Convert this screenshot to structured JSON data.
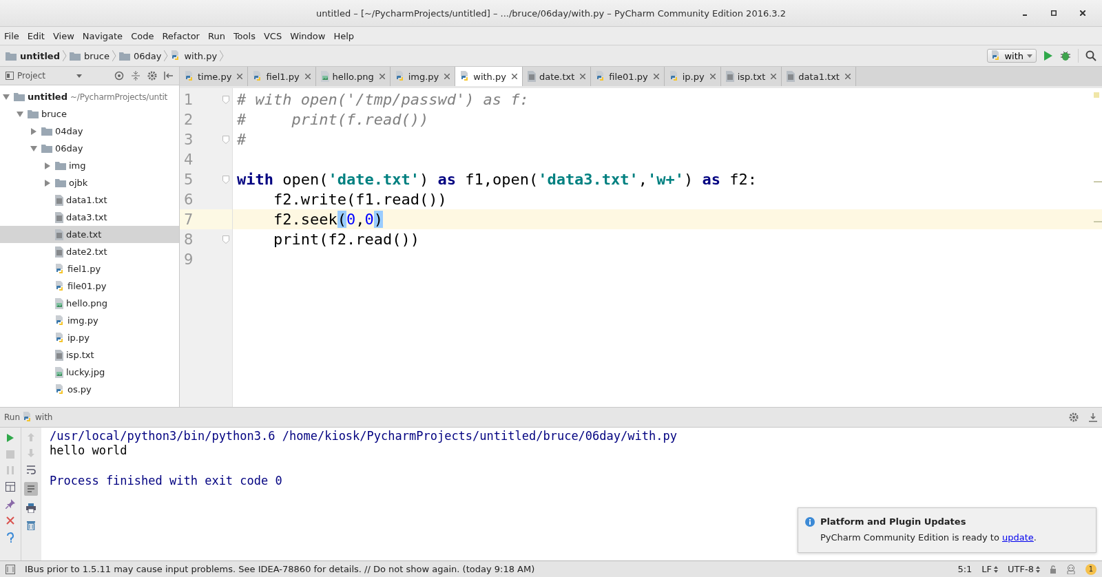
{
  "window": {
    "title": "untitled – [~/PycharmProjects/untitled] – .../bruce/06day/with.py – PyCharm Community Edition 2016.3.2"
  },
  "menu": [
    "File",
    "Edit",
    "View",
    "Navigate",
    "Code",
    "Refactor",
    "Run",
    "Tools",
    "VCS",
    "Window",
    "Help"
  ],
  "breadcrumbs": [
    {
      "label": "untitled",
      "kind": "folder",
      "bold": true
    },
    {
      "label": "bruce",
      "kind": "folder",
      "bold": false
    },
    {
      "label": "06day",
      "kind": "folder",
      "bold": false
    },
    {
      "label": "with.py",
      "kind": "py",
      "bold": false
    }
  ],
  "run_config": {
    "label": "with"
  },
  "project_panel": {
    "title": "Project"
  },
  "tree": [
    {
      "label": "untitled",
      "path": "~/PycharmProjects/untit",
      "kind": "folder",
      "expanded": true,
      "selected": false,
      "children": [
        {
          "label": "bruce",
          "kind": "folder",
          "expanded": true,
          "selected": false,
          "children": [
            {
              "label": "04day",
              "kind": "folder",
              "expanded": false,
              "selected": false
            },
            {
              "label": "06day",
              "kind": "folder",
              "expanded": true,
              "selected": false,
              "children": [
                {
                  "label": "img",
                  "kind": "folder",
                  "expanded": false,
                  "selected": false
                },
                {
                  "label": "ojbk",
                  "kind": "folder",
                  "expanded": false,
                  "selected": false
                },
                {
                  "label": "data1.txt",
                  "kind": "txt",
                  "selected": false
                },
                {
                  "label": "data3.txt",
                  "kind": "txt",
                  "selected": false
                },
                {
                  "label": "date.txt",
                  "kind": "txt",
                  "selected": true
                },
                {
                  "label": "date2.txt",
                  "kind": "txt",
                  "selected": false
                },
                {
                  "label": "fiel1.py",
                  "kind": "py",
                  "selected": false
                },
                {
                  "label": "file01.py",
                  "kind": "py",
                  "selected": false
                },
                {
                  "label": "hello.png",
                  "kind": "image",
                  "selected": false
                },
                {
                  "label": "img.py",
                  "kind": "py",
                  "selected": false
                },
                {
                  "label": "ip.py",
                  "kind": "py",
                  "selected": false
                },
                {
                  "label": "isp.txt",
                  "kind": "txt",
                  "selected": false
                },
                {
                  "label": "lucky.jpg",
                  "kind": "image",
                  "selected": false
                },
                {
                  "label": "os.py",
                  "kind": "py",
                  "selected": false
                }
              ]
            }
          ]
        }
      ]
    }
  ],
  "tabs": [
    {
      "label": "time.py",
      "kind": "py",
      "selected": false
    },
    {
      "label": "fiel1.py",
      "kind": "py",
      "selected": false
    },
    {
      "label": "hello.png",
      "kind": "image",
      "selected": false
    },
    {
      "label": "img.py",
      "kind": "py",
      "selected": false
    },
    {
      "label": "with.py",
      "kind": "py",
      "selected": true
    },
    {
      "label": "date.txt",
      "kind": "txt",
      "selected": false
    },
    {
      "label": "file01.py",
      "kind": "py",
      "selected": false
    },
    {
      "label": "ip.py",
      "kind": "py",
      "selected": false
    },
    {
      "label": "isp.txt",
      "kind": "txt",
      "selected": false
    },
    {
      "label": "data1.txt",
      "kind": "txt",
      "selected": false
    }
  ],
  "editor": {
    "lines": [
      {
        "number": "1",
        "current": false,
        "fold": true,
        "tokens": [
          {
            "t": "# with open('/tmp/passwd') as f:",
            "kind": "comment"
          }
        ]
      },
      {
        "number": "2",
        "current": false,
        "fold": false,
        "tokens": [
          {
            "t": "#     print(f.read())",
            "kind": "comment"
          }
        ]
      },
      {
        "number": "3",
        "current": false,
        "fold": true,
        "tokens": [
          {
            "t": "#",
            "kind": "comment"
          }
        ]
      },
      {
        "number": "4",
        "current": false,
        "fold": false
      },
      {
        "number": "5",
        "current": false,
        "fold": true,
        "tokens": [
          {
            "t": "with",
            "kind": "keyword"
          },
          {
            "t": " open(",
            "kind": "plain"
          },
          {
            "t": "'date.txt'",
            "kind": "string"
          },
          {
            "t": ") ",
            "kind": "plain"
          },
          {
            "t": "as",
            "kind": "keyword"
          },
          {
            "t": " f1,open(",
            "kind": "plain"
          },
          {
            "t": "'data3.txt'",
            "kind": "string"
          },
          {
            "t": ",",
            "kind": "plain"
          },
          {
            "t": "'w+'",
            "kind": "string"
          },
          {
            "t": ") ",
            "kind": "plain"
          },
          {
            "t": "as",
            "kind": "keyword"
          },
          {
            "t": " f2:",
            "kind": "plain"
          }
        ]
      },
      {
        "number": "6",
        "current": false,
        "fold": false,
        "tokens": [
          {
            "t": "    f2.write(f1.read())",
            "kind": "plain"
          }
        ]
      },
      {
        "number": "7",
        "current": true,
        "fold": false,
        "tokens": [
          {
            "t": "    f2.seek",
            "kind": "plain"
          },
          {
            "t": "(",
            "kind": "brace"
          },
          {
            "t": "0",
            "kind": "number"
          },
          {
            "t": ",",
            "kind": "plain"
          },
          {
            "t": "0",
            "kind": "number"
          },
          {
            "t": ")",
            "kind": "brace"
          }
        ]
      },
      {
        "number": "8",
        "current": false,
        "fold": true,
        "tokens": [
          {
            "t": "    print(f2.read())",
            "kind": "plain"
          }
        ]
      },
      {
        "number": "9",
        "current": false,
        "fold": false
      }
    ]
  },
  "run_panel": {
    "title": "Run",
    "config": "with",
    "console": [
      {
        "text": "/usr/local/python3/bin/python3.6 /home/kiosk/PycharmProjects/untitled/bruce/06day/with.py",
        "kind": "command"
      },
      {
        "text": "hello world",
        "kind": "output"
      },
      {
        "text": "Process finished with exit code 0",
        "kind": "info"
      }
    ]
  },
  "notification": {
    "title": "Platform and Plugin Updates",
    "body": "PyCharm Community Edition is ready to ",
    "link": "update",
    "after": "."
  },
  "status_bar": {
    "message": "IBus prior to 1.5.11 may cause input problems. See IDEA-78860 for details. // Do not show again. (today 9:18 AM)",
    "position": "5:1",
    "line_separator": "LF",
    "encoding": "UTF-8",
    "event_count": "1"
  }
}
